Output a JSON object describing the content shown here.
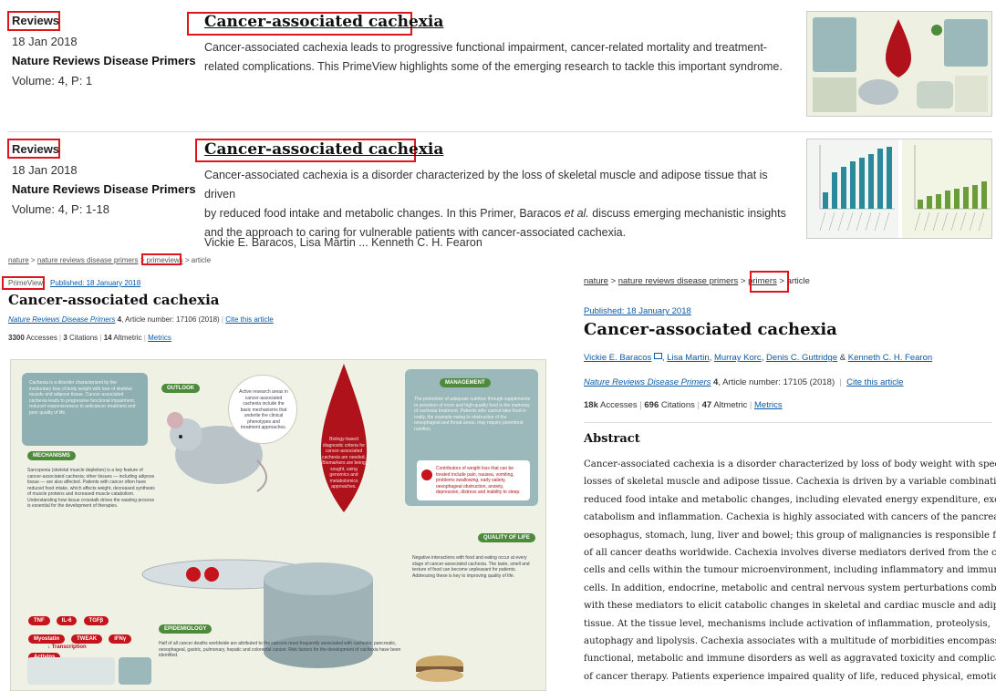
{
  "results": [
    {
      "type": "Reviews",
      "date": "18 Jan 2018",
      "journal": "Nature Reviews Disease Primers",
      "volume": "Volume: 4, P: 1",
      "title": "Cancer-associated cachexia",
      "description_line1": "Cancer-associated cachexia leads to progressive functional impairment, cancer-related mortality and treatment-",
      "description_line2": "related complications. This PrimeView highlights some of the emerging research to tackle this important syndrome."
    },
    {
      "type": "Reviews",
      "date": "18 Jan 2018",
      "journal": "Nature Reviews Disease Primers",
      "volume": "Volume: 4, P: 1-18",
      "title": "Cancer-associated cachexia",
      "description_line1": "Cancer-associated cachexia is a disorder characterized by the loss of skeletal muscle and adipose tissue that is driven",
      "description_line2": "by reduced food intake and metabolic changes. In this Primer, Baracos ",
      "description_italic": "et al.",
      "description_line2b": " discuss emerging mechanistic insights",
      "description_line3": "and the approach to caring for vulnerable patients with cancer-associated cachexia.",
      "authors": "Vickie E. Baracos, Lisa Martin ... Kenneth C. H. Fearon"
    }
  ],
  "left_article": {
    "breadcrumb": [
      "nature",
      "nature reviews disease primers",
      "primeviews",
      "article"
    ],
    "type_badge": "PrimeView",
    "published": "Published: 18 January 2018",
    "title": "Cancer-associated cachexia",
    "journal": "Nature Reviews Disease Primers",
    "volume_number": "4",
    "article_number": ", Article number: 17106 (2018)",
    "cite": "Cite this article",
    "accesses_n": "3300",
    "accesses_label": "Accesses",
    "citations_n": "3",
    "citations_label": "Citations",
    "altmetric_n": "14",
    "altmetric_label": "Altmetric",
    "metrics": "Metrics",
    "infographic": {
      "outlook": "OUTLOOK",
      "mechanisms": "MECHANISMS",
      "management": "MANAGEMENT",
      "quality": "QUALITY OF LIFE",
      "epidemiology": "EPIDEMIOLOGY",
      "markers": [
        "TNF",
        "IL-6",
        "TGFβ",
        "Myostatin",
        "TWEAK",
        "IFNγ",
        "Activins"
      ],
      "transcription": "↓ Transcription"
    }
  },
  "right_article": {
    "breadcrumb": [
      "nature",
      "nature reviews disease primers",
      "primers",
      "article"
    ],
    "published": "Published: 18 January 2018",
    "title": "Cancer-associated cachexia",
    "authors": [
      "Vickie E. Baracos",
      "Lisa Martin",
      "Murray Korc",
      "Denis C. Guttridge",
      "Kenneth C. H. Fearon"
    ],
    "journal": "Nature Reviews Disease Primers",
    "volume_number": "4",
    "article_number": ", Article number: 17105 (2018)",
    "cite": "Cite this article",
    "accesses_n": "18k",
    "accesses_label": "Accesses",
    "citations_n": "696",
    "citations_label": "Citations",
    "altmetric_n": "47",
    "altmetric_label": "Altmetric",
    "metrics": "Metrics",
    "abstract_heading": "Abstract",
    "abstract_lines": [
      "Cancer-associated cachexia is a disorder characterized by loss of body weight with specific",
      "losses of skeletal muscle and adipose tissue. Cachexia is driven by a variable combination of",
      "reduced food intake and metabolic changes, including elevated energy expenditure, excess",
      "catabolism and inflammation. Cachexia is highly associated with cancers of the pancreas,",
      "oesophagus, stomach, lung, liver and bowel; this group of malignancies is responsible for half",
      "of all cancer deaths worldwide. Cachexia involves diverse mediators derived from the cancer",
      "cells and cells within the tumour microenvironment, including inflammatory and immune",
      "cells. In addition, endocrine, metabolic and central nervous system perturbations combine",
      "with these mediators to elicit catabolic changes in skeletal and cardiac muscle and adipose",
      "tissue. At the tissue level, mechanisms include activation of inflammation, proteolysis,",
      "autophagy and lipolysis. Cachexia associates with a multitude of morbidities encompassing",
      "functional, metabolic and immune disorders as well as aggravated toxicity and complications",
      "of cancer therapy. Patients experience impaired quality of life, reduced physical, emotional"
    ]
  },
  "colors": {
    "highlight": "#e0141e",
    "link": "#0a5aa8",
    "teal_bar": "#2b8a9a",
    "green_bar": "#6a9c3a",
    "blood_red": "#b0121c"
  }
}
